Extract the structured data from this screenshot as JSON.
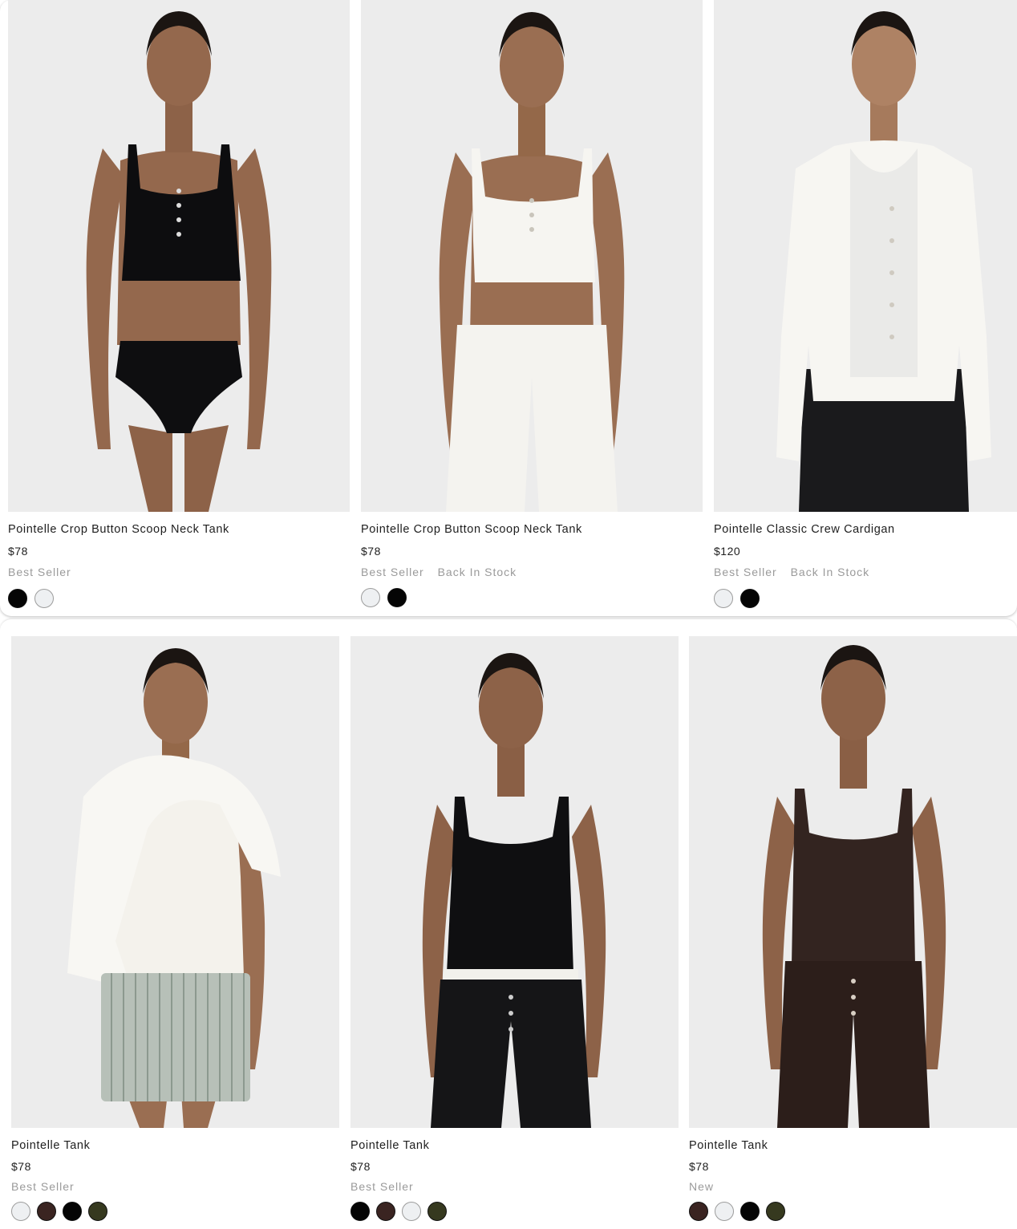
{
  "colors": {
    "black": "#050505",
    "white": "#eef0f2",
    "brown": "#3a2421",
    "olive": "#36391f"
  },
  "products": [
    {
      "name": "Pointelle Crop Button Scoop Neck Tank",
      "price": "$78",
      "badges": [
        "Best Seller"
      ],
      "swatches": [
        "black",
        "white"
      ],
      "image": "model-black-crop-tank-and-brief"
    },
    {
      "name": "Pointelle Crop Button Scoop Neck Tank",
      "price": "$78",
      "badges": [
        "Best Seller",
        "Back In Stock"
      ],
      "swatches": [
        "white",
        "black"
      ],
      "image": "model-white-crop-tank-and-pants"
    },
    {
      "name": "Pointelle Classic Crew Cardigan",
      "price": "$120",
      "badges": [
        "Best Seller",
        "Back In Stock"
      ],
      "swatches": [
        "white",
        "black"
      ],
      "image": "model-white-cardigan-black-pants"
    },
    {
      "name": "Pointelle Tank",
      "price": "$78",
      "badges": [
        "Best Seller"
      ],
      "swatches": [
        "white",
        "brown",
        "black",
        "olive"
      ],
      "image": "model-white-tank-striped-shorts"
    },
    {
      "name": "Pointelle Tank",
      "price": "$78",
      "badges": [
        "Best Seller"
      ],
      "swatches": [
        "black",
        "brown",
        "white",
        "olive"
      ],
      "image": "model-black-tank-black-pants"
    },
    {
      "name": "Pointelle Tank",
      "price": "$78",
      "badges": [
        "New"
      ],
      "swatches": [
        "brown",
        "white",
        "black",
        "olive"
      ],
      "image": "model-brown-tank-brown-pants"
    }
  ]
}
